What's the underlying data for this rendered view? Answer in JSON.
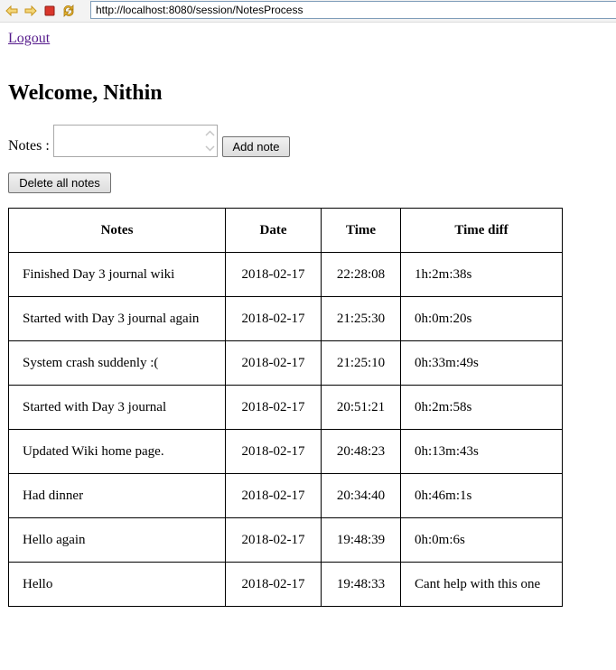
{
  "browser": {
    "url": "http://localhost:8080/session/NotesProcess"
  },
  "page": {
    "logout_label": "Logout",
    "welcome": "Welcome, Nithin",
    "notes_label": "Notes :",
    "notes_value": "",
    "add_note_label": "Add note",
    "delete_all_label": "Delete all notes"
  },
  "table": {
    "headers": [
      "Notes",
      "Date",
      "Time",
      "Time diff"
    ],
    "rows": [
      {
        "note": "Finished Day 3 journal wiki",
        "date": "2018-02-17",
        "time": "22:28:08",
        "diff": "1h:2m:38s"
      },
      {
        "note": "Started with Day 3 journal again",
        "date": "2018-02-17",
        "time": "21:25:30",
        "diff": "0h:0m:20s"
      },
      {
        "note": "System crash suddenly :(",
        "date": "2018-02-17",
        "time": "21:25:10",
        "diff": "0h:33m:49s"
      },
      {
        "note": "Started with Day 3 journal",
        "date": "2018-02-17",
        "time": "20:51:21",
        "diff": "0h:2m:58s"
      },
      {
        "note": "Updated Wiki home page.",
        "date": "2018-02-17",
        "time": "20:48:23",
        "diff": "0h:13m:43s"
      },
      {
        "note": "Had dinner",
        "date": "2018-02-17",
        "time": "20:34:40",
        "diff": "0h:46m:1s"
      },
      {
        "note": "Hello again",
        "date": "2018-02-17",
        "time": "19:48:39",
        "diff": "0h:0m:6s"
      },
      {
        "note": "Hello",
        "date": "2018-02-17",
        "time": "19:48:33",
        "diff": "Cant help with this one"
      }
    ]
  },
  "icons": {
    "back": "back-arrow-icon",
    "forward": "forward-arrow-icon",
    "stop": "stop-icon",
    "refresh": "refresh-icon"
  },
  "colors": {
    "link_visited": "#551a8b",
    "stop_red": "#d9362b",
    "arrow_yellow": "#e8b52c"
  }
}
